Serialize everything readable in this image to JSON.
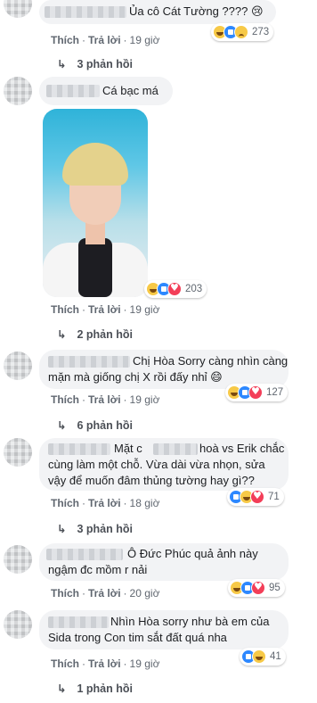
{
  "comments": [
    {
      "text_lines": [
        "Ủa cô Cát Tường ???? 😢"
      ],
      "actions": {
        "like": "Thích",
        "reply": "Trả lời",
        "time": "19 giờ"
      },
      "reactions": {
        "icons": [
          "haha-icon",
          "like-icon",
          "sad-icon"
        ],
        "count": "273"
      },
      "replies": "3 phản hồi"
    },
    {
      "text_lines": [
        "Cá bạc má"
      ],
      "actions": {
        "like": "Thích",
        "reply": "Trả lời",
        "time": "19 giờ"
      },
      "reactions": {
        "icons": [
          "haha-icon",
          "like-icon",
          "love-icon"
        ],
        "count": "203"
      },
      "replies": "2 phản hồi"
    },
    {
      "text_lines": [
        "Chị Hòa Sorry càng nhìn càng",
        "mặn mà giống chị X rồi đấy nhỉ 😄"
      ],
      "actions": {
        "like": "Thích",
        "reply": "Trả lời",
        "time": "19 giờ"
      },
      "reactions": {
        "icons": [
          "haha-icon",
          "like-icon",
          "love-icon"
        ],
        "count": "127"
      },
      "replies": "6 phản hồi"
    },
    {
      "text_lines": [
        "Mặt c",
        "hoà vs Erik chắc",
        "cùng làm một chỗ. Vừa dài vừa nhọn, sửa",
        "vậy để muốn đâm thủng tường hay gì??"
      ],
      "actions": {
        "like": "Thích",
        "reply": "Trả lời",
        "time": "18 giờ"
      },
      "reactions": {
        "icons": [
          "like-icon",
          "haha-icon",
          "love-icon"
        ],
        "count": "71"
      },
      "replies": "3 phản hồi"
    },
    {
      "text_lines": [
        "Ô Đức Phúc quả ảnh này",
        "ngậm đc mồm r nải"
      ],
      "actions": {
        "like": "Thích",
        "reply": "Trả lời",
        "time": "20 giờ"
      },
      "reactions": {
        "icons": [
          "haha-icon",
          "like-icon",
          "love-icon"
        ],
        "count": "95"
      },
      "replies": "3 phản hồi"
    },
    {
      "text_lines": [
        "Nhìn Hòa sorry như bà em của",
        "Sida trong Con tim sắt đất quá nha"
      ],
      "actions": {
        "like": "Thích",
        "reply": "Trả lời",
        "time": "19 giờ"
      },
      "reactions": {
        "icons": [
          "like-icon",
          "haha-icon"
        ],
        "count": "41"
      },
      "replies": "1 phản hồi"
    }
  ]
}
